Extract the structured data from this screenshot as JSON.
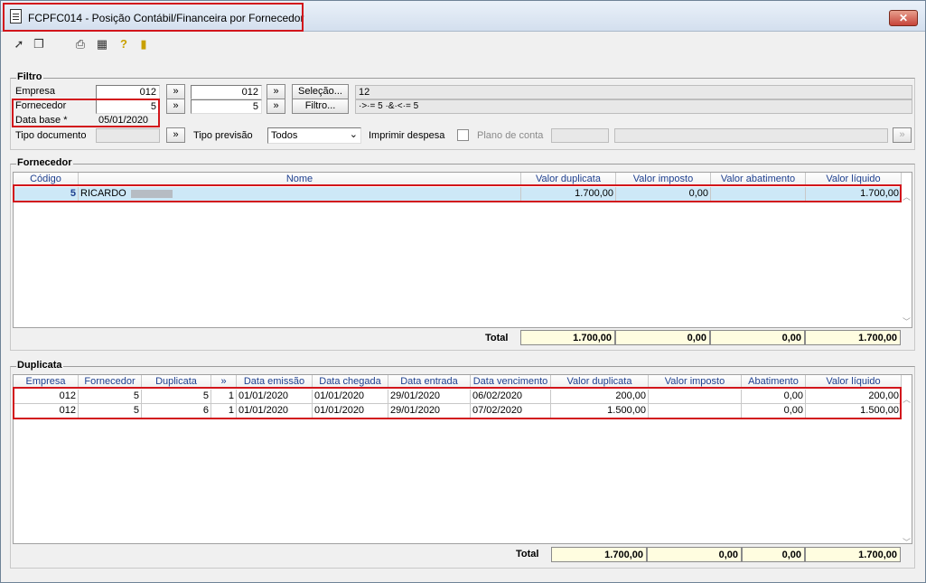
{
  "window": {
    "title": "FCPFC014 - Posição Contábil/Financeira por Fornecedor",
    "close": "✕"
  },
  "toolbar": {
    "icons": [
      "cursor-icon",
      "copy-icon",
      "print-icon",
      "grid-icon",
      "help-icon",
      "exit-icon"
    ]
  },
  "filtro": {
    "title": "Filtro",
    "empresa_label": "Empresa",
    "empresa_from": "012",
    "empresa_to": "012",
    "empresa_range_btn": "»",
    "empresa_to_btn": "»",
    "selecao_btn": "Seleção...",
    "empresa_result": "12",
    "fornecedor_label": "Fornecedor",
    "fornecedor_from": "5",
    "fornecedor_to": "5",
    "fornecedor_range_btn": "»",
    "fornecedor_to_btn": "»",
    "filtro_btn": "Filtro...",
    "fornecedor_expr": "·>·= 5 ·&·<·= 5",
    "database_label": "Data base *",
    "database_value": "05/01/2020",
    "tipodoc_label": "Tipo documento",
    "tipodoc_btn": "»",
    "tipoprev_label": "Tipo previsão",
    "tipoprev_value": "Todos",
    "imprimir_label": "Imprimir despesa",
    "plano_label": "Plano de conta",
    "plano_btn": "»"
  },
  "fornecedor": {
    "title": "Fornecedor",
    "columns": [
      "Código",
      "Nome",
      "Valor duplicata",
      "Valor imposto",
      "Valor abatimento",
      "Valor líquido"
    ],
    "row": {
      "codigo": "5",
      "nome": "RICARDO",
      "valor_duplicata": "1.700,00",
      "valor_imposto": "0,00",
      "valor_abatimento": "",
      "valor_liquido": "1.700,00"
    },
    "total_label": "Total",
    "total_duplicata": "1.700,00",
    "total_imposto": "0,00",
    "total_abatimento": "0,00",
    "total_liquido": "1.700,00"
  },
  "duplicata": {
    "title": "Duplicata",
    "columns": [
      "Empresa",
      "Fornecedor",
      "Duplicata",
      "»",
      "Data emissão",
      "Data chegada",
      "Data entrada",
      "Data vencimento",
      "Valor duplicata",
      "Valor imposto",
      "Abatimento",
      "Valor líquido"
    ],
    "rows": [
      [
        "012",
        "5",
        "5",
        "1",
        "01/01/2020",
        "01/01/2020",
        "29/01/2020",
        "06/02/2020",
        "200,00",
        "",
        "0,00",
        "200,00"
      ],
      [
        "012",
        "5",
        "6",
        "1",
        "01/01/2020",
        "01/01/2020",
        "29/01/2020",
        "07/02/2020",
        "1.500,00",
        "",
        "0,00",
        "1.500,00"
      ]
    ],
    "total_label": "Total",
    "total_duplicata": "1.700,00",
    "total_imposto": "0,00",
    "total_abatimento": "0,00",
    "total_liquido": "1.700,00"
  }
}
